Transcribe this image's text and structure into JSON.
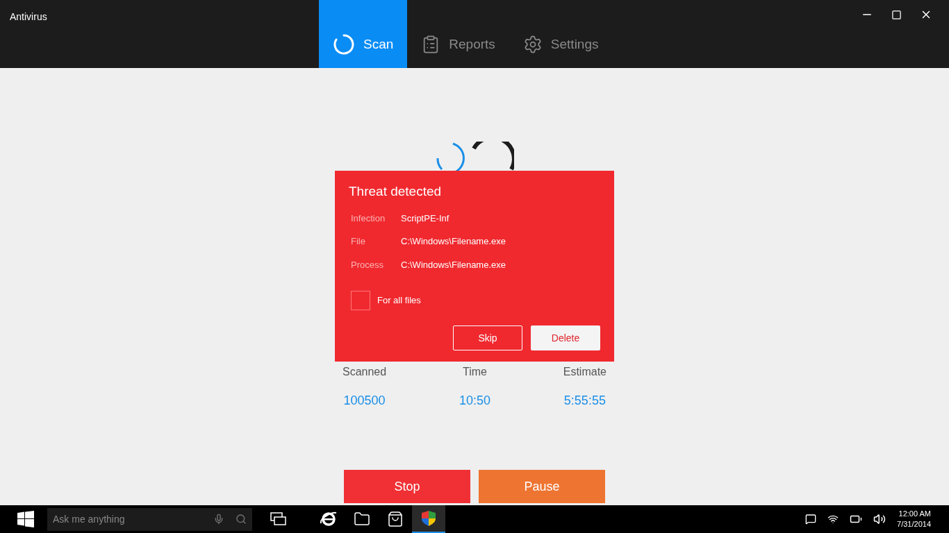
{
  "window": {
    "title": "Antivirus"
  },
  "tabs": [
    {
      "label": "Scan",
      "kind": "spinner",
      "selected": true
    },
    {
      "label": "Reports",
      "kind": "clipboard",
      "selected": false
    },
    {
      "label": "Settings",
      "kind": "gear",
      "selected": false
    }
  ],
  "stats": [
    {
      "label": "Scanned",
      "value": "100500"
    },
    {
      "label": "Time",
      "value": "10:50"
    },
    {
      "label": "Estimate",
      "value": "5:55:55"
    }
  ],
  "dialog": {
    "title": "Threat detected",
    "fields": [
      {
        "label": "Infection",
        "value": "ScriptPE-Inf"
      },
      {
        "label": "File",
        "value": "C:\\Windows\\Filename.exe"
      },
      {
        "label": "Process",
        "value": "C:\\Windows\\Filename.exe"
      }
    ],
    "checkbox": {
      "label": "For all files",
      "checked": false
    },
    "buttons": [
      {
        "label": "Skip",
        "kind": "outline"
      },
      {
        "label": "Delete",
        "kind": "solid"
      }
    ]
  },
  "actions": [
    {
      "label": "Stop",
      "color": "#f03034"
    },
    {
      "label": "Pause",
      "color": "#ee7431"
    }
  ],
  "taskbar": {
    "search": {
      "placeholder": "Ask me anything"
    },
    "apps": [
      {
        "kind": "task-view",
        "selected": false
      },
      {
        "kind": "browser",
        "selected": false
      },
      {
        "kind": "folder",
        "selected": false
      },
      {
        "kind": "store",
        "selected": false
      },
      {
        "kind": "shield",
        "selected": true
      }
    ],
    "clock": {
      "time": "12:00 AM",
      "date": "7/31/2014"
    }
  }
}
